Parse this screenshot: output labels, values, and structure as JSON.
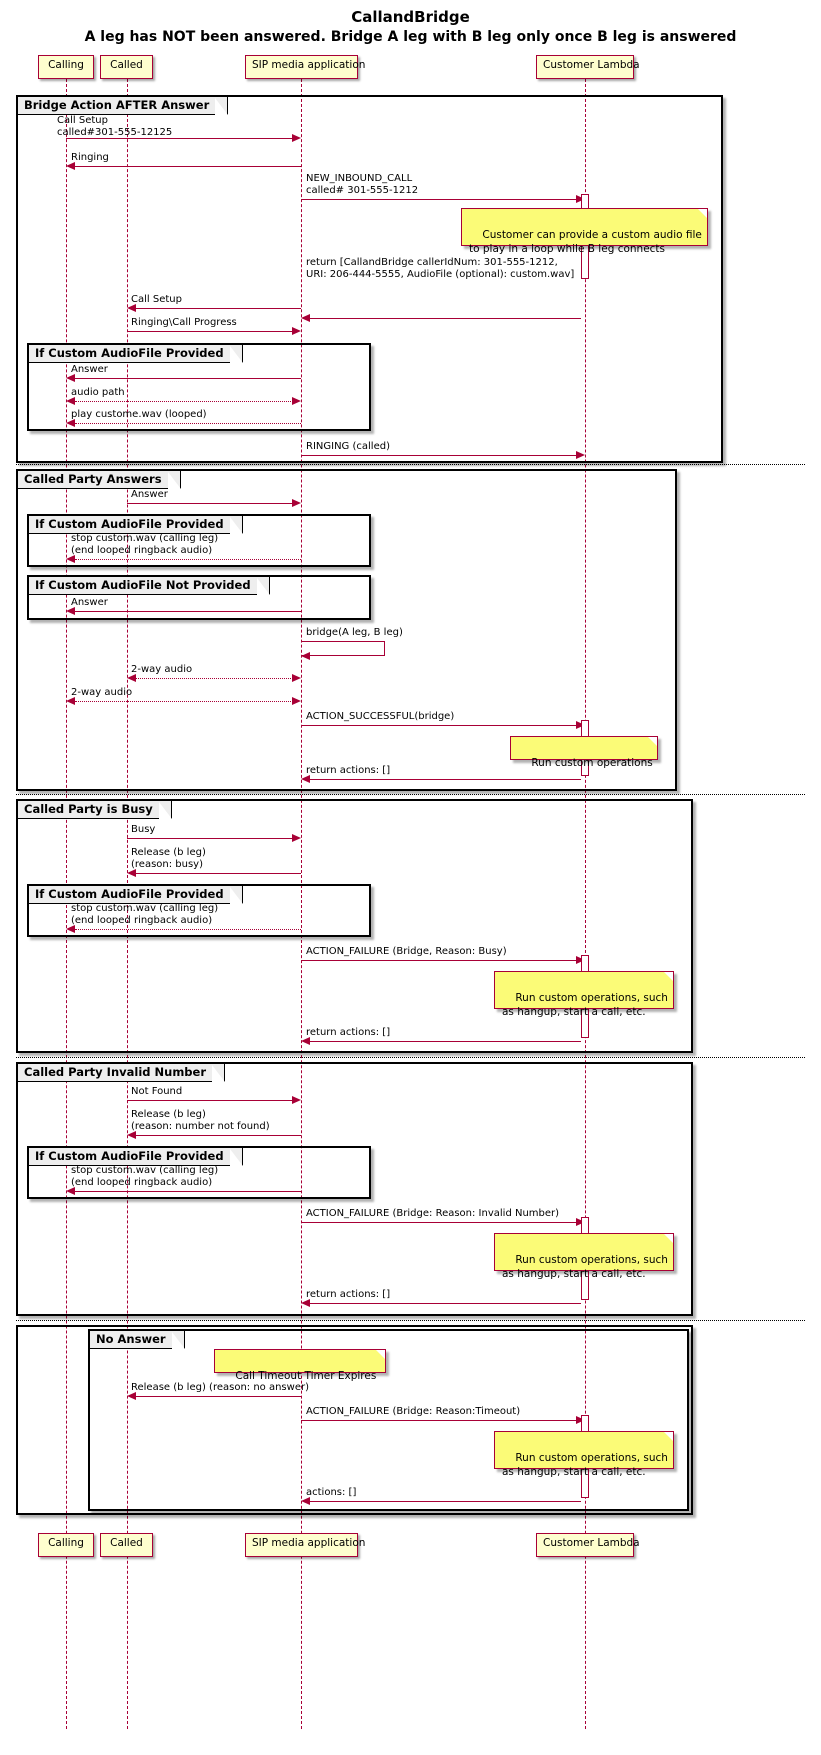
{
  "diagram": {
    "title_line1": "CallandBridge",
    "title_line2": "A leg has NOT been answered. Bridge A leg with B leg only once B leg is answered"
  },
  "participants": [
    {
      "id": "calling",
      "label": "Calling"
    },
    {
      "id": "called",
      "label": "Called"
    },
    {
      "id": "sip",
      "label": "SIP media application"
    },
    {
      "id": "lambda",
      "label": "Customer Lambda"
    }
  ],
  "groups": {
    "bridge_after_answer": "Bridge Action AFTER Answer",
    "custom_audio_provided_1": "If Custom AudioFile Provided",
    "called_party_answers": "Called Party Answers",
    "custom_audio_provided_2": "If Custom AudioFile Provided",
    "custom_audio_not_provided": "If Custom AudioFile Not Provided",
    "called_party_busy": "Called Party is Busy",
    "custom_audio_provided_3": "If Custom AudioFile Provided",
    "called_party_invalid": "Called Party Invalid Number",
    "custom_audio_provided_4": "If Custom AudioFile Provided",
    "no_answer": "No Answer"
  },
  "messages": {
    "call_setup_in": "Call Setup\ncalled#301-555-12125",
    "ringing": "Ringing",
    "new_inbound_call": "NEW_INBOUND_CALL\ncalled# 301-555-1212",
    "return_callandbridge": "return [CallandBridge callerIdNum: 301-555-1212,\nURI: 206-444-5555, AudioFile (optional): custom.wav]",
    "call_setup_out": "Call Setup",
    "ringing_call_progress": "Ringing\\Call Progress",
    "answer_1": "Answer",
    "audio_path": "audio path",
    "play_custom_looped": "play custome.wav (looped)",
    "ringing_called": "RINGING (called)",
    "answer_2": "Answer",
    "stop_custom_1": "stop custom.wav (calling leg)\n(end looped ringback audio)",
    "answer_3": "Answer",
    "bridge_self": "bridge(A leg, B leg)",
    "two_way_audio_b": "2-way audio",
    "two_way_audio_a": "2-way audio",
    "action_successful": "ACTION_SUCCESSFUL(bridge)",
    "return_actions_1": "return actions: []",
    "busy": "Busy",
    "release_busy": "Release (b leg)\n(reason: busy)",
    "stop_custom_2": "stop custom.wav (calling leg)\n(end looped ringback audio)",
    "action_failure_busy": "ACTION_FAILURE (Bridge, Reason: Busy)",
    "return_actions_2": "return actions: []",
    "not_found": "Not Found",
    "release_not_found": "Release (b leg)\n(reason: number not found)",
    "stop_custom_3": "stop custom.wav (calling leg)\n(end looped ringback audio)",
    "action_failure_invalid": "ACTION_FAILURE (Bridge: Reason: Invalid Number)",
    "return_actions_3": "return actions: []",
    "release_no_answer": "Release (b leg) (reason: no answer)",
    "action_failure_timeout": "ACTION_FAILURE (Bridge: Reason:Timeout)",
    "actions_empty": "actions: []"
  },
  "notes": {
    "custom_audio_file": "Customer can provide a custom audio file\nto play in a loop while B leg connects",
    "run_custom_operations": "Run custom operations",
    "run_custom_operations_such_1": "Run custom operations, such\nas hangup, start a call, etc.",
    "run_custom_operations_such_2": "Run custom operations, such\nas hangup, start a call, etc.",
    "call_timeout_timer": "Call Timeout Timer Expires",
    "run_custom_operations_such_3": "Run custom operations, such\nas hangup, start a call, etc."
  },
  "colors": {
    "accent": "#A80036",
    "participant_fill": "#FEFECE",
    "note_fill": "#FBFB77",
    "group_label_fill": "#EEEEEE"
  }
}
